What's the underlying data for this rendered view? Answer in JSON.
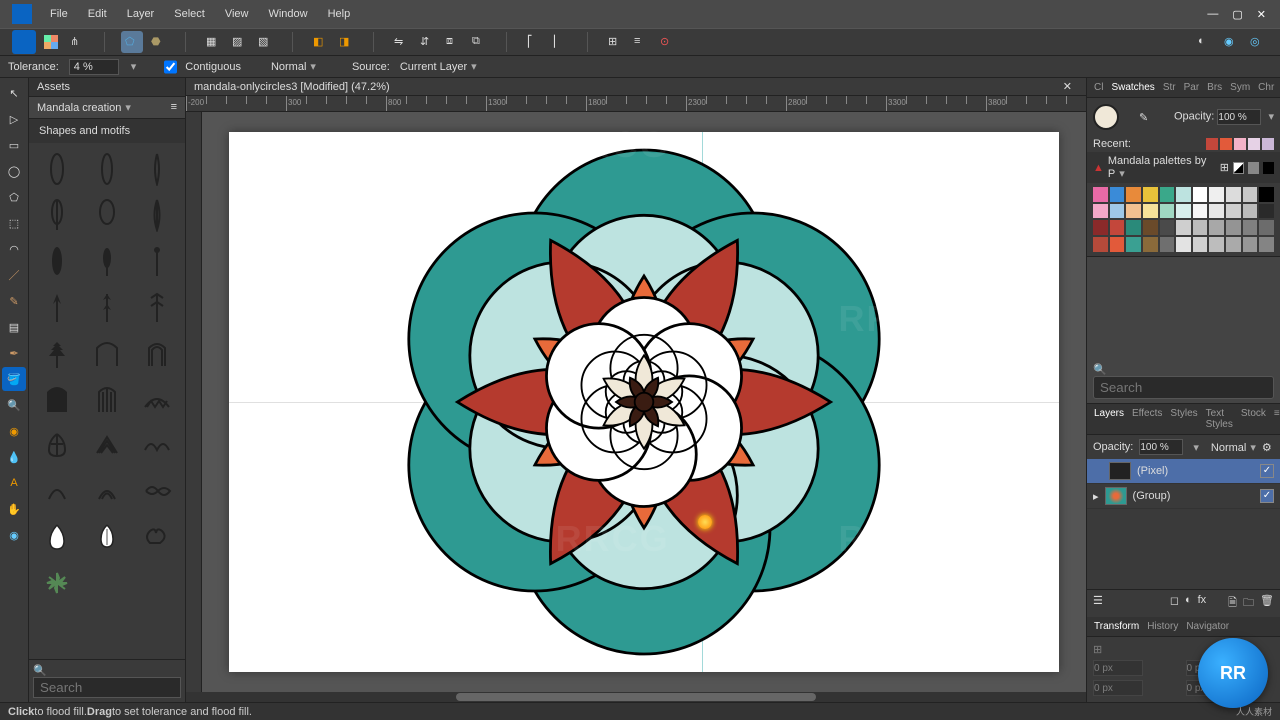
{
  "menu": {
    "items": [
      "File",
      "Edit",
      "Layer",
      "Select",
      "View",
      "Window",
      "Help"
    ]
  },
  "contextbar": {
    "tolerance_label": "Tolerance:",
    "tolerance_value": "4 %",
    "contiguous_label": "Contiguous",
    "contiguous_checked": true,
    "blend_label": "Normal",
    "source_label": "Source:",
    "source_value": "Current Layer"
  },
  "document": {
    "tab_title": "mandala-onlycircles3 [Modified] (47.2%)"
  },
  "assets": {
    "panel_title": "Assets",
    "category": "Mandala creation",
    "section": "Shapes and motifs",
    "search_placeholder": "Search"
  },
  "right": {
    "top_tabs": [
      "Cl",
      "Swatches",
      "Str",
      "Par",
      "Brs",
      "Sym",
      "Chr"
    ],
    "top_active": "Swatches",
    "opacity_label": "Opacity:",
    "opacity_value": "100 %",
    "recent_label": "Recent:",
    "recent_colors": [
      "#c3473b",
      "#e25a3a",
      "#f3b2c8",
      "#e6d2e6",
      "#cbb8d8"
    ],
    "palette_name": "Mandala palettes by P",
    "palette_colors": [
      "#e86aa6",
      "#3a8bd8",
      "#e88a3a",
      "#e8c23a",
      "#3aa88a",
      "#bde3e0",
      "#ffffff",
      "#efefef",
      "#dcdcdc",
      "#c8c8c8",
      "#000000",
      "#f3a8c8",
      "#9fc8e8",
      "#f3c090",
      "#f6e29a",
      "#9fd8c2",
      "#d8efec",
      "#f6f6f6",
      "#e6e6e6",
      "#cfcfcf",
      "#bcbcbc",
      "#2a2a2a",
      "#8a2a2a",
      "#c3473b",
      "#2a8a7a",
      "#6a4a2a",
      "#4a4a4a",
      "#cfcfcf",
      "#bcbcbc",
      "#a8a8a8",
      "#949494",
      "#808080",
      "#6c6c6c",
      "#b54a3a",
      "#e25a3a",
      "#3aa092",
      "#8a6a3a",
      "#6f6f6f",
      "#e3e3e3",
      "#d0d0d0",
      "#bdbdbd",
      "#aaaaaa",
      "#979797",
      "#848484"
    ],
    "search_placeholder": "Search",
    "layers_tabs": [
      "Layers",
      "Effects",
      "Styles",
      "Text Styles",
      "Stock"
    ],
    "layers_active": "Layers",
    "layers_opacity_label": "Opacity:",
    "layers_opacity_value": "100 %",
    "layers_blend": "Normal",
    "layer_items": [
      {
        "name": "(Pixel)",
        "selected": true,
        "expandable": false
      },
      {
        "name": "(Group)",
        "selected": false,
        "expandable": true
      }
    ],
    "transform_tabs": [
      "Transform",
      "History",
      "Navigator"
    ],
    "transform_active": "Transform",
    "transform_px": "0 px"
  },
  "statusbar": {
    "text_a": "Click",
    "text_b": " to flood fill. ",
    "text_c": "Drag",
    "text_d": " to set tolerance and flood fill."
  },
  "mandala_colors": {
    "outer": "#2e9a92",
    "mid": "#bde3e0",
    "petal_red": "#b53a2e",
    "petal_orange": "#e86a3a",
    "center_dark": "#3a1c12",
    "cream": "#f0e8d8"
  }
}
